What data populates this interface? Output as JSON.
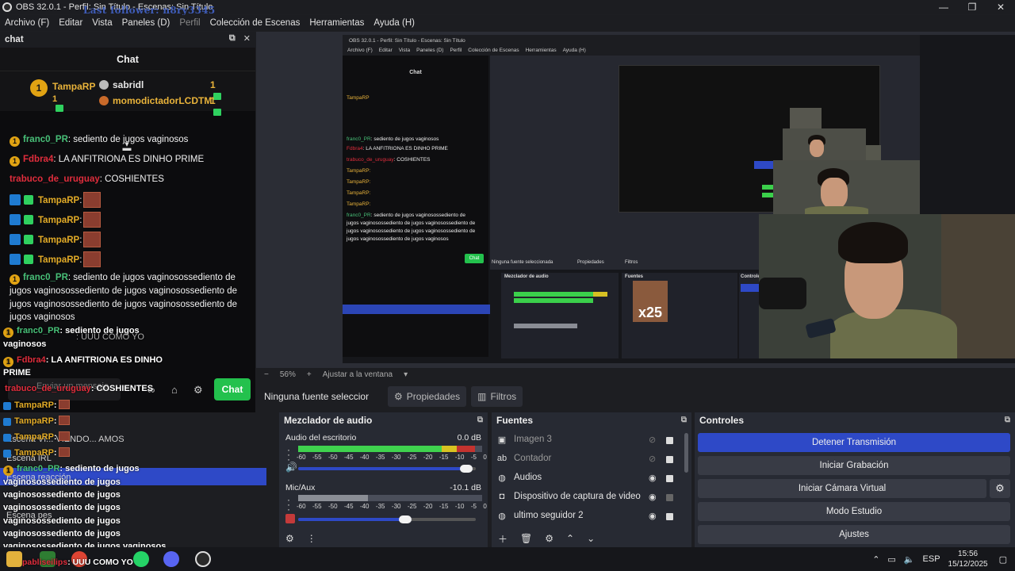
{
  "window": {
    "title": "OBS 32.0.1 - Perfil: Sin Título - Escenas: Sin Título",
    "overlay_follower": "Last follower: n8ry3345",
    "controls": [
      "—",
      "❐",
      "✕"
    ]
  },
  "menu": {
    "items": [
      "Archivo (F)",
      "Editar",
      "Vista",
      "Paneles (D)",
      "Perfil",
      "Colección de Escenas",
      "Herramientas",
      "Ayuda (H)"
    ]
  },
  "chat_dock": {
    "dock_title": "chat",
    "header": "Chat",
    "leaderboard": {
      "first": {
        "rank": "1",
        "name": "TampaRP",
        "count": "1"
      },
      "rows": [
        {
          "name": "sabridl",
          "count": "1"
        },
        {
          "name": "momodictadorLCDTM",
          "count": "1"
        }
      ]
    },
    "messages": [
      {
        "user": "franc0_PR",
        "text": ": sediento de jugos vaginosos"
      },
      {
        "user": "Fdbra4",
        "text": ": LA ANFITRIONA ES DINHO PRIME"
      },
      {
        "user": "trabuco_de_uruguay",
        "text": ": COSHIENTES"
      },
      {
        "user": "TampaRP",
        "text": ":"
      },
      {
        "user": "TampaRP",
        "text": ":"
      },
      {
        "user": "TampaRP",
        "text": ":"
      },
      {
        "user": "TampaRP",
        "text": ":"
      },
      {
        "user": "franc0_PR",
        "text": ": sediento de jugos vaginosossediento de jugos vaginosossediento de jugos vaginosossediento de jugos vaginosossediento de jugos vaginosossediento de jugos vaginosos"
      }
    ],
    "input_placeholder": "Enviar un mensaje",
    "send_label": "Chat"
  },
  "overlay_chat": [
    {
      "user": "franc0_PR",
      "text": ": sediento de jugos"
    },
    {
      "user": "",
      "text": "vaginosos"
    },
    {
      "user": "Fdbra4",
      "text": ": LA ANFITRIONA ES DINHO"
    },
    {
      "user": "",
      "text": "PRIME"
    },
    {
      "user": "trabuco_de_uruguay",
      "text": ": COSHIENTES"
    },
    {
      "user": "TampaRP",
      "text": ":"
    },
    {
      "user": "TampaRP",
      "text": ":"
    },
    {
      "user": "TampaRP",
      "text": ":"
    },
    {
      "user": "TampaRP",
      "text": ":"
    },
    {
      "user": "franc0_PR",
      "text": ": sediento de jugos"
    },
    {
      "user": "",
      "text": "vaginosossediento de jugos"
    },
    {
      "user": "",
      "text": "vaginosossediento de jugos"
    },
    {
      "user": "",
      "text": "vaginosossediento de jugos"
    },
    {
      "user": "",
      "text": "vaginosossediento de jugos"
    },
    {
      "user": "",
      "text": "vaginosossediento de jugos"
    },
    {
      "user": "",
      "text": "vaginosossediento de jugos vaginosos"
    },
    {
      "user": "pabliseilips",
      "text": ": UUU COMO YO"
    }
  ],
  "overlay_misc": {
    "uuu_como_yo": ": UUU COMO YO",
    "scene_a": "Escena IRL",
    "scene_b": "Escena reacción",
    "scene_c": "Escena pes",
    "escena_viendo": "Escena VI... VIENDO... AMOS"
  },
  "preview": {
    "zoom": "56%",
    "fit_label": "Ajustar a la ventana",
    "nested_title": "OBS 32.0.1 - Perfil: Sin Título - Escenas: Sin Título",
    "nested_menu": [
      "Archivo (F)",
      "Editar",
      "Vista",
      "Paneles (D)",
      "Perfil",
      "Colección de Escenas",
      "Herramientas",
      "Ayuda (H)"
    ],
    "nested_chat": "Chat",
    "nested_none": "Ninguna fuente seleccionada",
    "nested_props": "Propiedades",
    "nested_filters": "Filtros",
    "nested_mixer": "Mezclador de audio",
    "nested_sources": "Fuentes",
    "nested_controls": "Controles",
    "x25": "x25"
  },
  "source_toolbar": {
    "none_selected": "Ninguna fuente seleccionada",
    "properties": "Propiedades",
    "filters": "Filtros"
  },
  "mixer": {
    "title": "Mezclador de audio",
    "ticks": [
      "-60",
      "-55",
      "-50",
      "-45",
      "-40",
      "-35",
      "-30",
      "-25",
      "-20",
      "-15",
      "-10",
      "-5",
      "0"
    ],
    "tracks": [
      {
        "name": "Audio del escritorio",
        "db": "0.0 dB",
        "level": 0.96,
        "volume": 0.98
      },
      {
        "name": "Mic/Aux",
        "db": "-10.1 dB",
        "level": 0.38,
        "volume": 0.64
      }
    ]
  },
  "sources": {
    "title": "Fuentes",
    "items": [
      {
        "name": "Imagen 3",
        "dim": true
      },
      {
        "name": "Contador",
        "dim": true
      },
      {
        "name": "Audios",
        "dim": false
      },
      {
        "name": "Dispositivo de captura de video",
        "dim": false
      },
      {
        "name": "ultimo seguidor 2",
        "dim": false
      }
    ]
  },
  "controls": {
    "title": "Controles",
    "buttons": [
      "Detener Transmisión",
      "Iniciar Grabación",
      "Iniciar Cámara Virtual",
      "Modo Estudio",
      "Ajustes"
    ]
  },
  "taskbar": {
    "lang": "ESP",
    "time": "15:56",
    "date": "15/12/2025"
  }
}
